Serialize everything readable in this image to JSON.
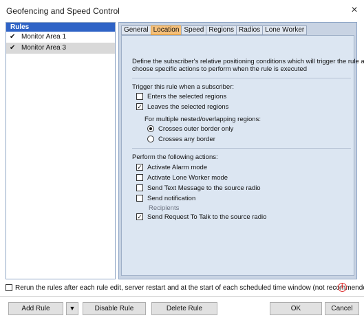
{
  "window": {
    "title": "Geofencing and Speed Control",
    "close_label": "×"
  },
  "rules": {
    "header": "Rules",
    "items": [
      {
        "label": "Monitor Area 1",
        "checked": true,
        "selected": false
      },
      {
        "label": "Monitor Area 3",
        "checked": true,
        "selected": true
      }
    ]
  },
  "tabs": [
    "General",
    "Location",
    "Speed",
    "Regions",
    "Radios",
    "Lone Worker"
  ],
  "active_tab": "Location",
  "location": {
    "description_line1": "Define the subscriber's relative positioning conditions which will trigger the rule and",
    "description_line2": "choose specific actions to perform when the rule is executed",
    "trigger_heading": "Trigger this rule when a subscriber:",
    "enters_label": "Enters the selected regions",
    "enters_checked": false,
    "leaves_label": "Leaves the selected regions",
    "leaves_checked": true,
    "nested_heading": "For multiple nested/overlapping regions:",
    "outer_border_label": "Crosses outer border only",
    "any_border_label": "Crosses any border",
    "selected_border": "outer",
    "actions_heading": "Perform the following actions:",
    "alarm_label": "Activate Alarm mode",
    "alarm_checked": true,
    "lone_worker_label": "Activate Lone Worker mode",
    "lone_worker_checked": false,
    "text_message_label": "Send Text Message to the source radio",
    "text_message_checked": false,
    "notification_label": "Send notification",
    "notification_checked": false,
    "recipients_label": "Recipients",
    "request_talk_label": "Send Request To Talk to the source radio",
    "request_talk_checked": true
  },
  "rerun": {
    "label": "Rerun the rules after each rule edit, server restart and at the start of each scheduled time window (not recommended)",
    "checked": false,
    "info_icon": "i"
  },
  "buttons": {
    "add_rule": "Add Rule",
    "add_rule_dropdown": "▼",
    "disable_rule": "Disable Rule",
    "delete_rule": "Delete Rule",
    "ok": "OK",
    "cancel": "Cancel"
  },
  "colors": {
    "rules_header_bg": "#2f63c6",
    "active_tab_bg": "#f6c07a",
    "panel_bg": "#c8d3e3",
    "content_bg": "#dce6f2"
  }
}
